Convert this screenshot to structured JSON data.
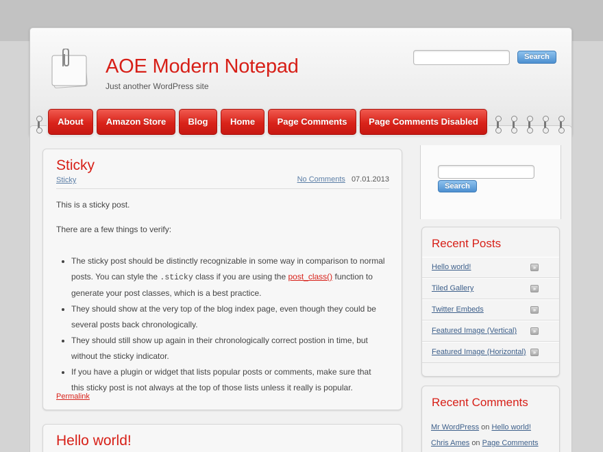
{
  "site": {
    "title": "AOE Modern Notepad",
    "description": "Just another WordPress site"
  },
  "header_search": {
    "value": "",
    "button_label": "Search"
  },
  "nav": {
    "items": [
      {
        "label": "About"
      },
      {
        "label": "Amazon Store"
      },
      {
        "label": "Blog"
      },
      {
        "label": "Home"
      },
      {
        "label": "Page Comments"
      },
      {
        "label": "Page Comments Disabled"
      }
    ]
  },
  "post": {
    "title": "Sticky",
    "category": "Sticky",
    "comments_link": "No Comments",
    "date": "07.01.2013",
    "para1": "This is a sticky post.",
    "para2": "There are a few things to verify:",
    "bullet1_a": "The sticky post should be distinctly recognizable in some way in comparison to normal posts. You can style the ",
    "bullet1_code": ".sticky",
    "bullet1_b": " class if you are using the ",
    "bullet1_link": "post_class()",
    "bullet1_c": " function to generate your post classes, which is a best practice.",
    "bullet2": "They should show at the very top of the blog index page, even though they could be several posts back chronologically.",
    "bullet3": "They should still show up again in their chronologically correct postion in time, but without the sticky indicator.",
    "bullet4": "If you have a plugin or widget that lists popular posts or comments, make sure that this sticky post is not always at the top of those lists unless it really is popular.",
    "permalink": "Permalink"
  },
  "post2": {
    "title": "Hello world!"
  },
  "sidebar_search": {
    "value": "",
    "button_label": "Search"
  },
  "recent_posts": {
    "title": "Recent Posts",
    "items": [
      {
        "label": "Hello world!"
      },
      {
        "label": "Tiled Gallery"
      },
      {
        "label": "Twitter Embeds"
      },
      {
        "label": "Featured Image (Vertical)"
      },
      {
        "label": "Featured Image (Horizontal)"
      }
    ],
    "arrow_glyph": "»"
  },
  "recent_comments": {
    "title": "Recent Comments",
    "items": [
      {
        "author": "Mr WordPress",
        "on": "on",
        "post": "Hello world!"
      },
      {
        "author": "Chris Ames",
        "on": "on",
        "post": "Page Comments"
      }
    ]
  },
  "colors": {
    "accent": "#d71f17",
    "link": "#5b7ea6",
    "button_blue": "#4d8fd0"
  },
  "icons": {
    "logo": "sticky-note-paperclip-icon"
  }
}
